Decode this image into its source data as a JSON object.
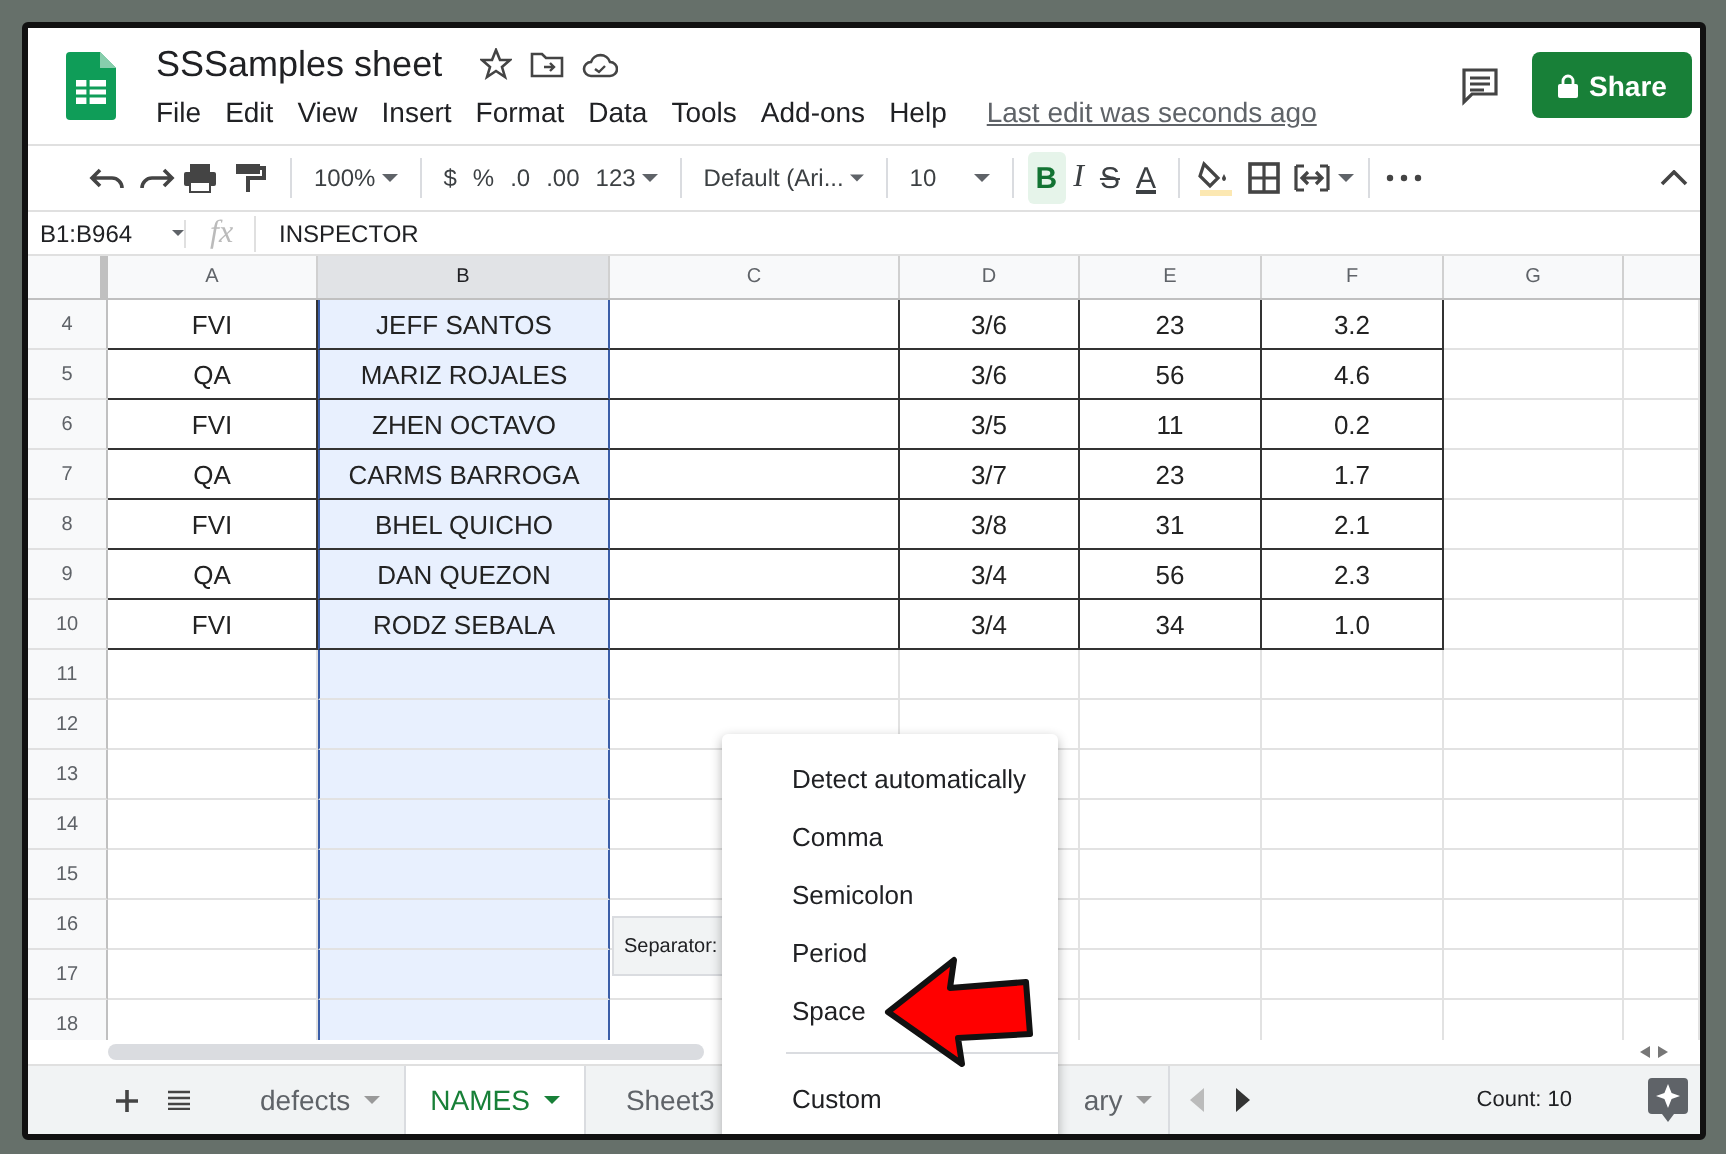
{
  "app": {
    "title": "SSSamples sheet",
    "menu": [
      "File",
      "Edit",
      "View",
      "Insert",
      "Format",
      "Data",
      "Tools",
      "Add-ons",
      "Help"
    ],
    "last_edit": "Last edit was seconds ago",
    "share": "Share"
  },
  "toolbar": {
    "zoom": "100%",
    "number_buttons": [
      "$",
      "%",
      ".0",
      ".00"
    ],
    "number_format": "123",
    "font": "Default (Ari...",
    "font_size": "10",
    "text_buttons": [
      {
        "kind": "bold",
        "label": "B",
        "on": true
      },
      {
        "kind": "italic",
        "label": "I",
        "on": false
      },
      {
        "kind": "strike",
        "label": "S",
        "on": false
      },
      {
        "kind": "color",
        "label": "A",
        "on": false
      }
    ]
  },
  "formula_bar": {
    "range": "B1:B964",
    "function_label": "fx",
    "value": "INSPECTOR"
  },
  "grid": {
    "columns": [
      {
        "label": "A",
        "selected": false
      },
      {
        "label": "B",
        "selected": true
      },
      {
        "label": "C",
        "selected": false
      },
      {
        "label": "D",
        "selected": false
      },
      {
        "label": "E",
        "selected": false
      },
      {
        "label": "F",
        "selected": false
      },
      {
        "label": "G",
        "selected": false
      }
    ],
    "rows": [
      {
        "number": "4",
        "a": "FVI",
        "b": "JEFF SANTOS",
        "d": "3/6",
        "e": "23",
        "f": "3.2"
      },
      {
        "number": "5",
        "a": "QA",
        "b": "MARIZ ROJALES",
        "d": "3/6",
        "e": "56",
        "f": "4.6"
      },
      {
        "number": "6",
        "a": "FVI",
        "b": "ZHEN OCTAVO",
        "d": "3/5",
        "e": "11",
        "f": "0.2"
      },
      {
        "number": "7",
        "a": "QA",
        "b": "CARMS BARROGA",
        "d": "3/7",
        "e": "23",
        "f": "1.7"
      },
      {
        "number": "8",
        "a": "FVI",
        "b": "BHEL QUICHO",
        "d": "3/8",
        "e": "31",
        "f": "2.1"
      },
      {
        "number": "9",
        "a": "QA",
        "b": "DAN QUEZON",
        "d": "3/4",
        "e": "56",
        "f": "2.3"
      },
      {
        "number": "10",
        "a": "FVI",
        "b": "RODZ SEBALA",
        "d": "3/4",
        "e": "34",
        "f": "1.0"
      },
      {
        "number": "11"
      },
      {
        "number": "12"
      },
      {
        "number": "13"
      },
      {
        "number": "14"
      },
      {
        "number": "15"
      },
      {
        "number": "16"
      },
      {
        "number": "17"
      },
      {
        "number": "18"
      }
    ]
  },
  "separator_chip": {
    "label": "Separator:"
  },
  "separator_menu": {
    "options": [
      "Detect automatically",
      "Comma",
      "Semicolon",
      "Period",
      "Space"
    ],
    "custom_option": "Custom"
  },
  "sheet_tabs": [
    {
      "label": "defects",
      "selected": false
    },
    {
      "label": "NAMES",
      "selected": true
    },
    {
      "label": "Sheet3",
      "selected": false
    },
    {
      "label": "ary",
      "selected": false
    }
  ],
  "status": {
    "count": "Count: 10"
  }
}
